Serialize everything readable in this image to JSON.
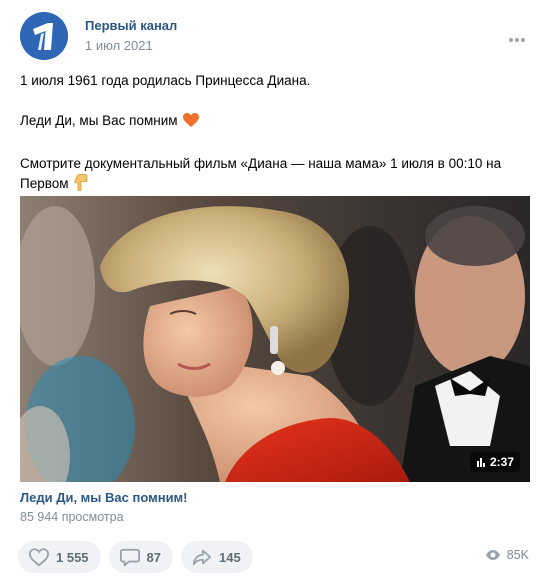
{
  "post": {
    "author": "Первый канал",
    "date": "1 июл 2021",
    "text_line1": "1 июля 1961 года родилась Принцесса Диана.",
    "text_line2": "Леди Ди, мы Вас помним",
    "text_line3": "Смотрите документальный фильм «Диана — наша мама» 1 июля в 00:10 на",
    "text_line4": "Первом",
    "emoji_heart": "orange-heart-icon",
    "emoji_hand": "pointing-down-hand-icon"
  },
  "video": {
    "duration": "2:37",
    "title": "Леди Ди, мы Вас помним!",
    "views": "85 944 просмотра"
  },
  "actions": {
    "likes": "1 555",
    "comments": "87",
    "shares": "145",
    "views": "85K"
  },
  "colors": {
    "link": "#2a5885",
    "muted": "#818c99",
    "action_bg": "#f0f2f5",
    "brand": "#2f67b6"
  }
}
